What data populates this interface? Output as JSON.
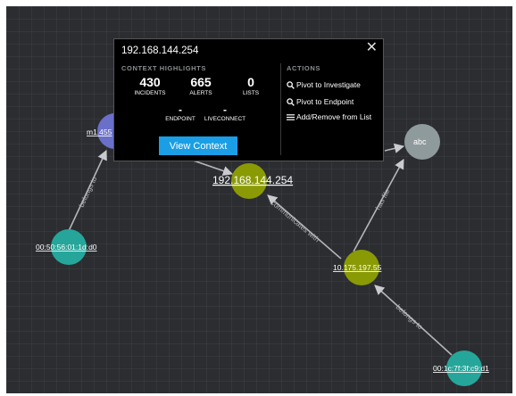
{
  "popup": {
    "title": "192.168.144.254",
    "close_glyph": "✕",
    "context_title": "CONTEXT HIGHLIGHTS",
    "actions_title": "ACTIONS",
    "stats": [
      {
        "value": "430",
        "label": "INCIDENTS"
      },
      {
        "value": "665",
        "label": "ALERTS"
      },
      {
        "value": "0",
        "label": "LISTS"
      }
    ],
    "stats2": [
      {
        "value": "-",
        "label": "ENDPOINT"
      },
      {
        "value": "-",
        "label": "LIVECONNECT"
      }
    ],
    "view_context_label": "View Context",
    "actions": [
      {
        "label": "Pivot to Investigate",
        "icon": "search-icon"
      },
      {
        "label": "Pivot to Endpoint",
        "icon": "search-icon"
      },
      {
        "label": "Add/Remove from List",
        "icon": "list-icon"
      }
    ]
  },
  "graph": {
    "nodes": {
      "ip_main": {
        "label": "192.168.144.254",
        "color": "#8a9a05"
      },
      "ip_second": {
        "label": "10.175.197.55",
        "color": "#8a9a05"
      },
      "mac_left": {
        "label": "00:50:56:01:1d:d0",
        "color": "#26a69a"
      },
      "mac_right": {
        "label": "00:1c:7f:3f:c9:d1",
        "color": "#26a69a"
      },
      "host": {
        "label": "m1.455",
        "color": "#6a6fc9"
      },
      "file": {
        "label": "abc",
        "color": "#8f9a9c"
      }
    },
    "edges": {
      "belongs_left": "belongs to",
      "communicates": "communicates with",
      "has_file": "has file",
      "belongs_right": "belongs to"
    }
  }
}
